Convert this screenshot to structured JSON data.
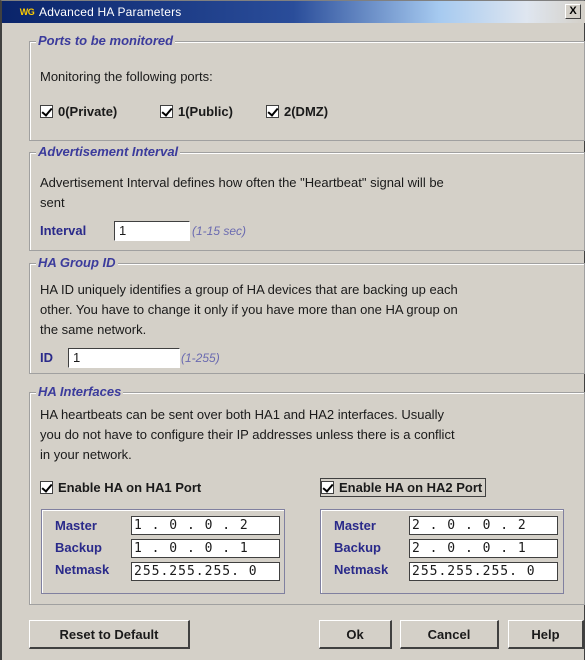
{
  "window": {
    "title": "Advanced HA Parameters",
    "logo": "WG",
    "close": "X"
  },
  "ports": {
    "title": "Ports to be monitored",
    "desc": "Monitoring the following ports:",
    "items": [
      {
        "label": "0(Private)",
        "checked": true
      },
      {
        "label": "1(Public)",
        "checked": true
      },
      {
        "label": "2(DMZ)",
        "checked": true
      }
    ]
  },
  "advertisement": {
    "title": "Advertisement Interval",
    "desc_line1": "Advertisement Interval defines how often the \"Heartbeat\" signal will be",
    "desc_line2": "sent",
    "interval_label": "Interval",
    "interval_value": "1",
    "interval_hint": "(1-15 sec)"
  },
  "group_id": {
    "title": "HA Group ID",
    "desc_line1": "HA ID uniquely identifies a group of HA devices that are backing up each",
    "desc_line2": "other. You have to change it only if you have more than one HA group on",
    "desc_line3": "the same network.",
    "id_label": "ID",
    "id_value": "1",
    "id_hint": "(1-255)"
  },
  "interfaces": {
    "title": "HA Interfaces",
    "desc_line1": "HA heartbeats can be sent over both HA1 and HA2 interfaces. Usually",
    "desc_line2": "you do not have to configure their IP addresses unless there is a conflict",
    "desc_line3": "in your network.",
    "ha1": {
      "enable_label": "Enable HA on HA1 Port",
      "checked": true,
      "master_label": "Master",
      "master": "1 . 0 . 0 . 2",
      "backup_label": "Backup",
      "backup": "1 . 0 . 0 . 1",
      "netmask_label": "Netmask",
      "netmask": "255.255.255. 0"
    },
    "ha2": {
      "enable_label": "Enable HA on HA2 Port",
      "checked": true,
      "master_label": "Master",
      "master": "2 . 0 . 0 . 2",
      "backup_label": "Backup",
      "backup": "2 . 0 . 0 . 1",
      "netmask_label": "Netmask",
      "netmask": "255.255.255. 0"
    }
  },
  "buttons": {
    "reset": "Reset to Default",
    "ok": "Ok",
    "cancel": "Cancel",
    "help": "Help"
  }
}
